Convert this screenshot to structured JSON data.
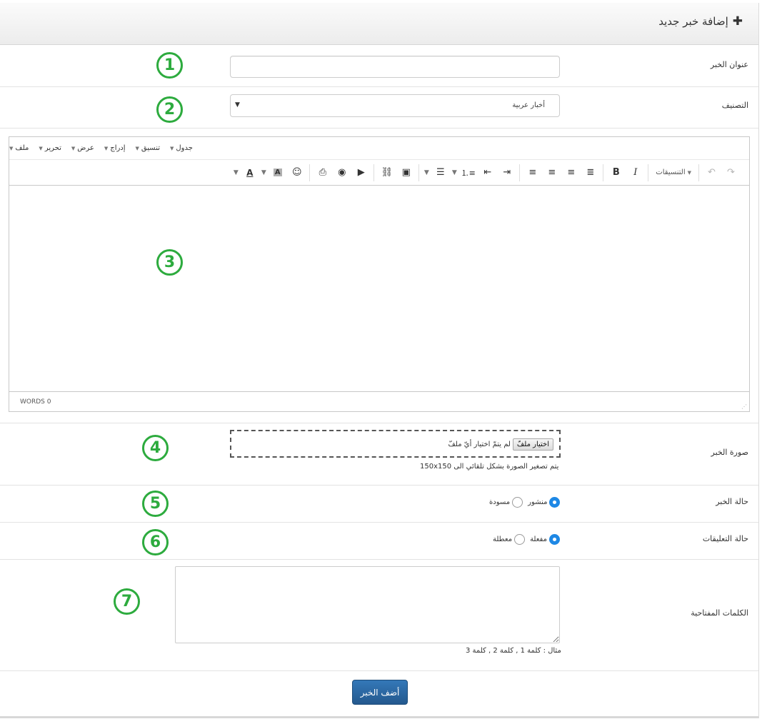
{
  "header": {
    "title": "إضافة خبر جديد",
    "icon": "plus-icon"
  },
  "fields": {
    "news_title": {
      "label": "عنوان الخبر",
      "value": "",
      "placeholder": ""
    },
    "category": {
      "label": "التصنيف",
      "selected": "أخبار عربية"
    },
    "image": {
      "label": "صورة الخبر",
      "button": "اختيار ملفّ",
      "status": "لم يتمّ اختيار أيّ ملفّ",
      "help": "يتم تصغير الصورة بشكل تلقائي الى 150x150"
    },
    "news_status": {
      "label": "حالة الخبر",
      "options": [
        "منشور",
        "مسودة"
      ],
      "selected": "منشور"
    },
    "comments_status": {
      "label": "حالة التعليقات",
      "options": [
        "مفعلة",
        "معطلة"
      ],
      "selected": "مفعلة"
    },
    "keywords": {
      "label": "الكلمات المفتاحية",
      "value": "",
      "help": "مثال : كلمة 1 , كلمة 2 , كلمة 3"
    }
  },
  "editor": {
    "menus": [
      "ملف",
      "تحرير",
      "عرض",
      "إدراج",
      "تنسيق",
      "جدول"
    ],
    "formats_label": "التنسيقات",
    "word_count": "WORDS 0"
  },
  "markers": [
    "1",
    "2",
    "3",
    "4",
    "5",
    "6",
    "7"
  ],
  "submit_label": "أضف الخبر",
  "colors": {
    "marker": "#2dab3e",
    "primary_button": "#2e6da4",
    "radio_selected": "#1e88e5"
  }
}
